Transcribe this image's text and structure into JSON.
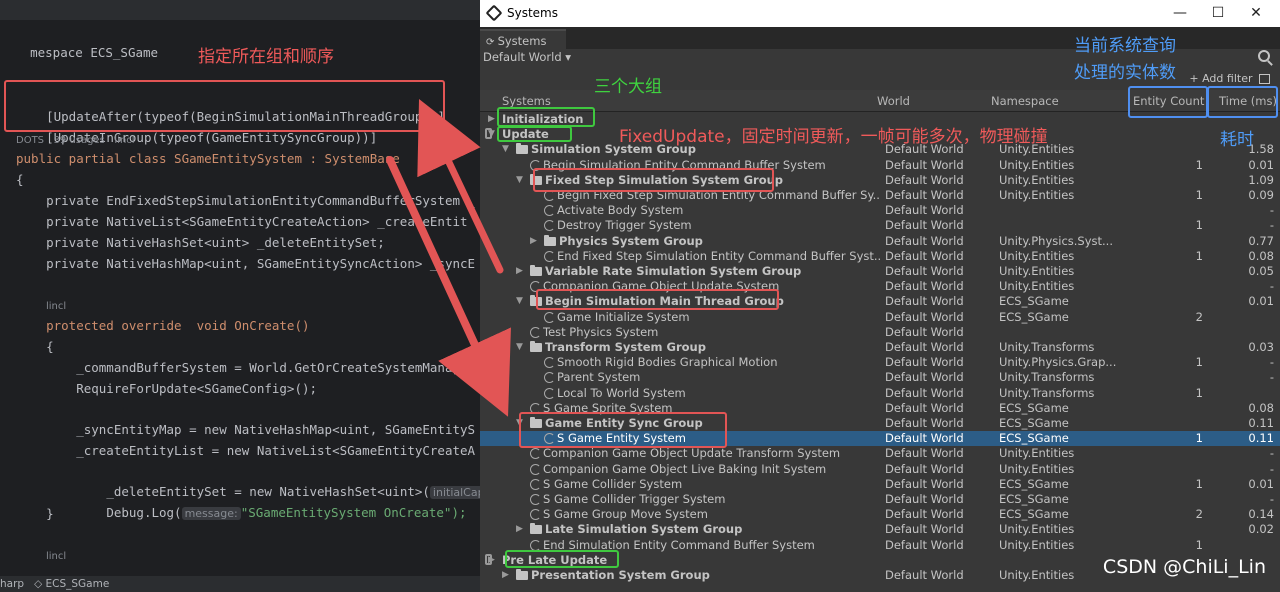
{
  "editor": {
    "namespace_line": "mespace ECS_SGame",
    "attr1": "[UpdateAfter(typeof(BeginSimulationMainThreadGroup))]",
    "attr2": "[UpdateInGroup(typeof(GameEntitySyncGroup))]",
    "meta1": "DOTS   39 usages   lincl",
    "class_decl": "public partial class SGameEntitySystem : SystemBase",
    "open_brace": "{",
    "field1": "    private EndFixedStepSimulationEntityCommandBufferSystem _",
    "field2": "    private NativeList<SGameEntityCreateAction> _createEntit",
    "field3": "    private NativeHashSet<uint> _deleteEntitySet;",
    "field4": "    private NativeHashMap<uint, SGameEntitySyncAction> _syncE",
    "meta2": "lincl",
    "oncreate": "    protected override  void OnCreate()",
    "brace2": "    {",
    "body1": "        _commandBufferSystem = World.GetOrCreateSystemManage",
    "body2": "        RequireForUpdate<SGameConfig>();",
    "body3": "        _syncEntityMap = new NativeHashMap<uint, SGameEntityS",
    "body4": "        _createEntityList = new NativeList<SGameEntityCreateA",
    "body5a": "        _deleteEntitySet = new NativeHashSet<uint>(",
    "body5hint": "initialCapacity",
    "body6a": "        Debug.Log(",
    "body6hint": "message:",
    "body6b": "\"SGameEntitySystem OnCreate\");",
    "brace3": "    }",
    "meta3": "lincl",
    "bottom": "harp   ◇ ECS_SGame"
  },
  "systems": {
    "window_title": "Systems",
    "tab": "Systems",
    "world_dropdown": "Default World ▾",
    "add_filter": "+ Add filter",
    "columns": {
      "systems": "Systems",
      "world": "World",
      "namespace": "Namespace",
      "entity_count": "Entity Count",
      "time": "Time (ms)"
    },
    "rows": [
      {
        "name": "Initialization",
        "world": "",
        "ns": "",
        "ec": "",
        "tm": "",
        "indent": 0,
        "kind": "root",
        "open": false,
        "bold": true
      },
      {
        "name": "Update",
        "world": "",
        "ns": "",
        "ec": "",
        "tm": "",
        "indent": 0,
        "kind": "root",
        "open": true,
        "bold": true
      },
      {
        "name": "Simulation System Group",
        "world": "Default World",
        "ns": "Unity.Entities",
        "ec": "",
        "tm": "1.58",
        "indent": 1,
        "kind": "group",
        "open": true,
        "bold": true
      },
      {
        "name": "Begin Simulation Entity Command Buffer System",
        "world": "Default World",
        "ns": "Unity.Entities",
        "ec": "1",
        "tm": "0.01",
        "indent": 2,
        "kind": "system"
      },
      {
        "name": "Fixed Step Simulation System Group",
        "world": "Default World",
        "ns": "Unity.Entities",
        "ec": "",
        "tm": "1.09",
        "indent": 2,
        "kind": "group",
        "open": true,
        "bold": true
      },
      {
        "name": "Begin Fixed Step Simulation Entity Command Buffer Sy...",
        "world": "Default World",
        "ns": "Unity.Entities",
        "ec": "1",
        "tm": "0.09",
        "indent": 3,
        "kind": "system"
      },
      {
        "name": "Activate Body System",
        "world": "Default World",
        "ns": "",
        "ec": "",
        "tm": "-",
        "indent": 3,
        "kind": "system"
      },
      {
        "name": "Destroy Trigger System",
        "world": "Default World",
        "ns": "",
        "ec": "1",
        "tm": "-",
        "indent": 3,
        "kind": "system"
      },
      {
        "name": "Physics System Group",
        "world": "Default World",
        "ns": "Unity.Physics.Syst...",
        "ec": "",
        "tm": "0.77",
        "indent": 3,
        "kind": "group",
        "open": false,
        "bold": true
      },
      {
        "name": "End Fixed Step Simulation Entity Command Buffer Syst...",
        "world": "Default World",
        "ns": "Unity.Entities",
        "ec": "1",
        "tm": "0.08",
        "indent": 3,
        "kind": "system"
      },
      {
        "name": "Variable Rate Simulation System Group",
        "world": "Default World",
        "ns": "Unity.Entities",
        "ec": "",
        "tm": "0.05",
        "indent": 2,
        "kind": "group",
        "open": false,
        "bold": true
      },
      {
        "name": "Companion Game Object Update System",
        "world": "Default World",
        "ns": "Unity.Entities",
        "ec": "",
        "tm": "-",
        "indent": 2,
        "kind": "system"
      },
      {
        "name": "Begin Simulation Main Thread Group",
        "world": "Default World",
        "ns": "ECS_SGame",
        "ec": "",
        "tm": "0.01",
        "indent": 2,
        "kind": "group",
        "open": true,
        "bold": true
      },
      {
        "name": "Game Initialize System",
        "world": "Default World",
        "ns": "ECS_SGame",
        "ec": "2",
        "tm": "",
        "indent": 3,
        "kind": "system"
      },
      {
        "name": "Test Physics System",
        "world": "Default World",
        "ns": "",
        "ec": "",
        "tm": "",
        "indent": 2,
        "kind": "system"
      },
      {
        "name": "Transform System Group",
        "world": "Default World",
        "ns": "Unity.Transforms",
        "ec": "",
        "tm": "0.03",
        "indent": 2,
        "kind": "group",
        "open": true,
        "bold": true
      },
      {
        "name": "Smooth Rigid Bodies Graphical Motion",
        "world": "Default World",
        "ns": "Unity.Physics.Grap...",
        "ec": "1",
        "tm": "-",
        "indent": 3,
        "kind": "system"
      },
      {
        "name": "Parent System",
        "world": "Default World",
        "ns": "Unity.Transforms",
        "ec": "",
        "tm": "-",
        "indent": 3,
        "kind": "system"
      },
      {
        "name": "Local To World System",
        "world": "Default World",
        "ns": "Unity.Transforms",
        "ec": "1",
        "tm": "",
        "indent": 3,
        "kind": "system"
      },
      {
        "name": "S Game Sprite System",
        "world": "Default World",
        "ns": "ECS_SGame",
        "ec": "",
        "tm": "0.08",
        "indent": 2,
        "kind": "system"
      },
      {
        "name": "Game Entity Sync Group",
        "world": "Default World",
        "ns": "ECS_SGame",
        "ec": "",
        "tm": "0.11",
        "indent": 2,
        "kind": "group",
        "open": true,
        "bold": true
      },
      {
        "name": "S Game Entity System",
        "world": "Default World",
        "ns": "ECS_SGame",
        "ec": "1",
        "tm": "0.11",
        "indent": 3,
        "kind": "system",
        "selected": true
      },
      {
        "name": "Companion Game Object Update Transform System",
        "world": "Default World",
        "ns": "Unity.Entities",
        "ec": "",
        "tm": "-",
        "indent": 2,
        "kind": "system"
      },
      {
        "name": "Companion Game Object Live Baking Init System",
        "world": "Default World",
        "ns": "Unity.Entities",
        "ec": "",
        "tm": "-",
        "indent": 2,
        "kind": "system"
      },
      {
        "name": "S Game Collider System",
        "world": "Default World",
        "ns": "ECS_SGame",
        "ec": "1",
        "tm": "0.01",
        "indent": 2,
        "kind": "system"
      },
      {
        "name": "S Game Collider Trigger System",
        "world": "Default World",
        "ns": "ECS_SGame",
        "ec": "",
        "tm": "-",
        "indent": 2,
        "kind": "system"
      },
      {
        "name": "S Game Group Move System",
        "world": "Default World",
        "ns": "ECS_SGame",
        "ec": "2",
        "tm": "0.14",
        "indent": 2,
        "kind": "system"
      },
      {
        "name": "Late Simulation System Group",
        "world": "Default World",
        "ns": "Unity.Entities",
        "ec": "",
        "tm": "0.02",
        "indent": 2,
        "kind": "group",
        "open": false,
        "bold": true
      },
      {
        "name": "End Simulation Entity Command Buffer System",
        "world": "Default World",
        "ns": "Unity.Entities",
        "ec": "1",
        "tm": "",
        "indent": 2,
        "kind": "system"
      },
      {
        "name": "Pre Late Update",
        "world": "",
        "ns": "",
        "ec": "",
        "tm": "",
        "indent": 0,
        "kind": "root",
        "open": false,
        "bold": true
      },
      {
        "name": "Presentation System Group",
        "world": "Default World",
        "ns": "Unity.Entities",
        "ec": "",
        "tm": "",
        "indent": 1,
        "kind": "group",
        "open": false,
        "bold": true
      }
    ]
  },
  "annotations": {
    "group_order": "指定所在组和顺序",
    "three_groups": "三个大组",
    "fixed_update": "FixedUpdate，固定时间更新，一帧可能多次，物理碰撞",
    "entity_count_note_1": "当前系统查询",
    "entity_count_note_2": "处理的实体数",
    "time_note": "耗时"
  },
  "watermark": "CSDN @ChiLi_Lin",
  "colors": {
    "annotation_red": "#e25555",
    "annotation_green": "#3fc83f",
    "annotation_blue": "#4f8ff0",
    "selection": "#2c5d87"
  }
}
